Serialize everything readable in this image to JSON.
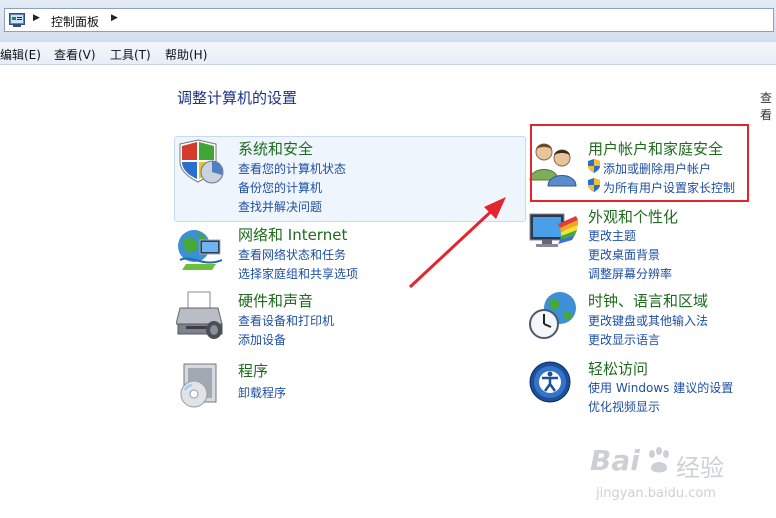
{
  "address": {
    "breadcrumb": "控制面板"
  },
  "menu": {
    "edit": "编辑(E)",
    "view": "查看(V)",
    "tools": "工具(T)",
    "help": "帮助(H)"
  },
  "page": {
    "title": "调整计算机的设置",
    "view_by": "查看"
  },
  "categories": {
    "system": {
      "title": "系统和安全",
      "links": [
        "查看您的计算机状态",
        "备份您的计算机",
        "查找并解决问题"
      ]
    },
    "network": {
      "title": "网络和 Internet",
      "links": [
        "查看网络状态和任务",
        "选择家庭组和共享选项"
      ]
    },
    "hardware": {
      "title": "硬件和声音",
      "links": [
        "查看设备和打印机",
        "添加设备"
      ]
    },
    "programs": {
      "title": "程序",
      "links": [
        "卸载程序"
      ]
    },
    "users": {
      "title": "用户帐户和家庭安全",
      "links": [
        "添加或删除用户帐户",
        "为所有用户设置家长控制"
      ]
    },
    "appearance": {
      "title": "外观和个性化",
      "links": [
        "更改主题",
        "更改桌面背景",
        "调整屏幕分辨率"
      ]
    },
    "clock": {
      "title": "时钟、语言和区域",
      "links": [
        "更改键盘或其他输入法",
        "更改显示语言"
      ]
    },
    "ease": {
      "title": "轻松访问",
      "links": [
        "使用 Windows 建议的设置",
        "优化视频显示"
      ]
    }
  },
  "watermark": {
    "brand": "Bai",
    "brand_cn": "经验",
    "url": "jingyan.baidu.com"
  },
  "colors": {
    "title": "#1e3287",
    "category": "#1e6a1e",
    "link": "#1e4fa3",
    "annotation": "#e4262c"
  }
}
